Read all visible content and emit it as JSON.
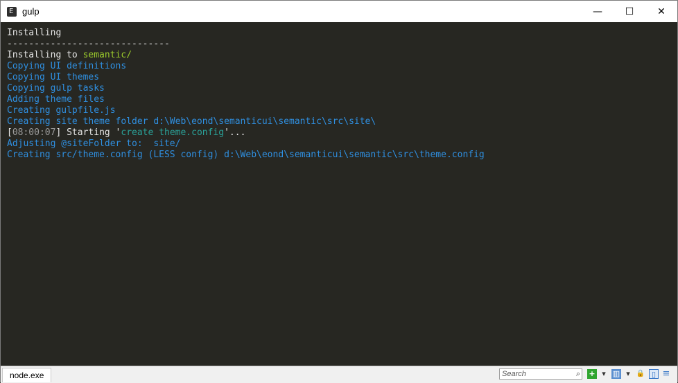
{
  "window": {
    "title": "gulp",
    "app_icon_glyph": "E",
    "controls": {
      "minimize": "—",
      "maximize": "☐",
      "close": "✕"
    }
  },
  "console": {
    "lines": [
      [
        {
          "text": "Installing",
          "color": "w"
        }
      ],
      [
        {
          "text": "------------------------------",
          "color": "w"
        }
      ],
      [
        {
          "text": "Installing to ",
          "color": "w"
        },
        {
          "text": "semantic/",
          "color": "g"
        }
      ],
      [
        {
          "text": "Copying UI definitions",
          "color": "b"
        }
      ],
      [
        {
          "text": "Copying UI themes",
          "color": "b"
        }
      ],
      [
        {
          "text": "Copying gulp tasks",
          "color": "b"
        }
      ],
      [
        {
          "text": "Adding theme files",
          "color": "b"
        }
      ],
      [
        {
          "text": "Creating gulpfile.js",
          "color": "b"
        }
      ],
      [
        {
          "text": "Creating site theme folder d:\\Web\\eond\\semanticui\\semantic\\src\\site\\",
          "color": "b"
        }
      ],
      [
        {
          "text": "[",
          "color": "w"
        },
        {
          "text": "08:00:07",
          "color": "gr"
        },
        {
          "text": "] Starting '",
          "color": "w"
        },
        {
          "text": "create theme.config",
          "color": "c"
        },
        {
          "text": "'...",
          "color": "w"
        }
      ],
      [
        {
          "text": "Adjusting @siteFolder to:  site/",
          "color": "b"
        }
      ],
      [
        {
          "text": "Creating src/theme.config (LESS config) d:\\Web\\eond\\semanticui\\semantic\\src\\theme.config",
          "color": "b"
        }
      ]
    ]
  },
  "statusbar": {
    "tab_label": "node.exe",
    "search_placeholder": "Search",
    "search_icon": "⌕",
    "add_icon": "+",
    "dropdown_icon": "▾",
    "view_icon": "▥",
    "lock_icon": "🔒",
    "panel_icon": "▯",
    "menu_icon": "≡"
  }
}
